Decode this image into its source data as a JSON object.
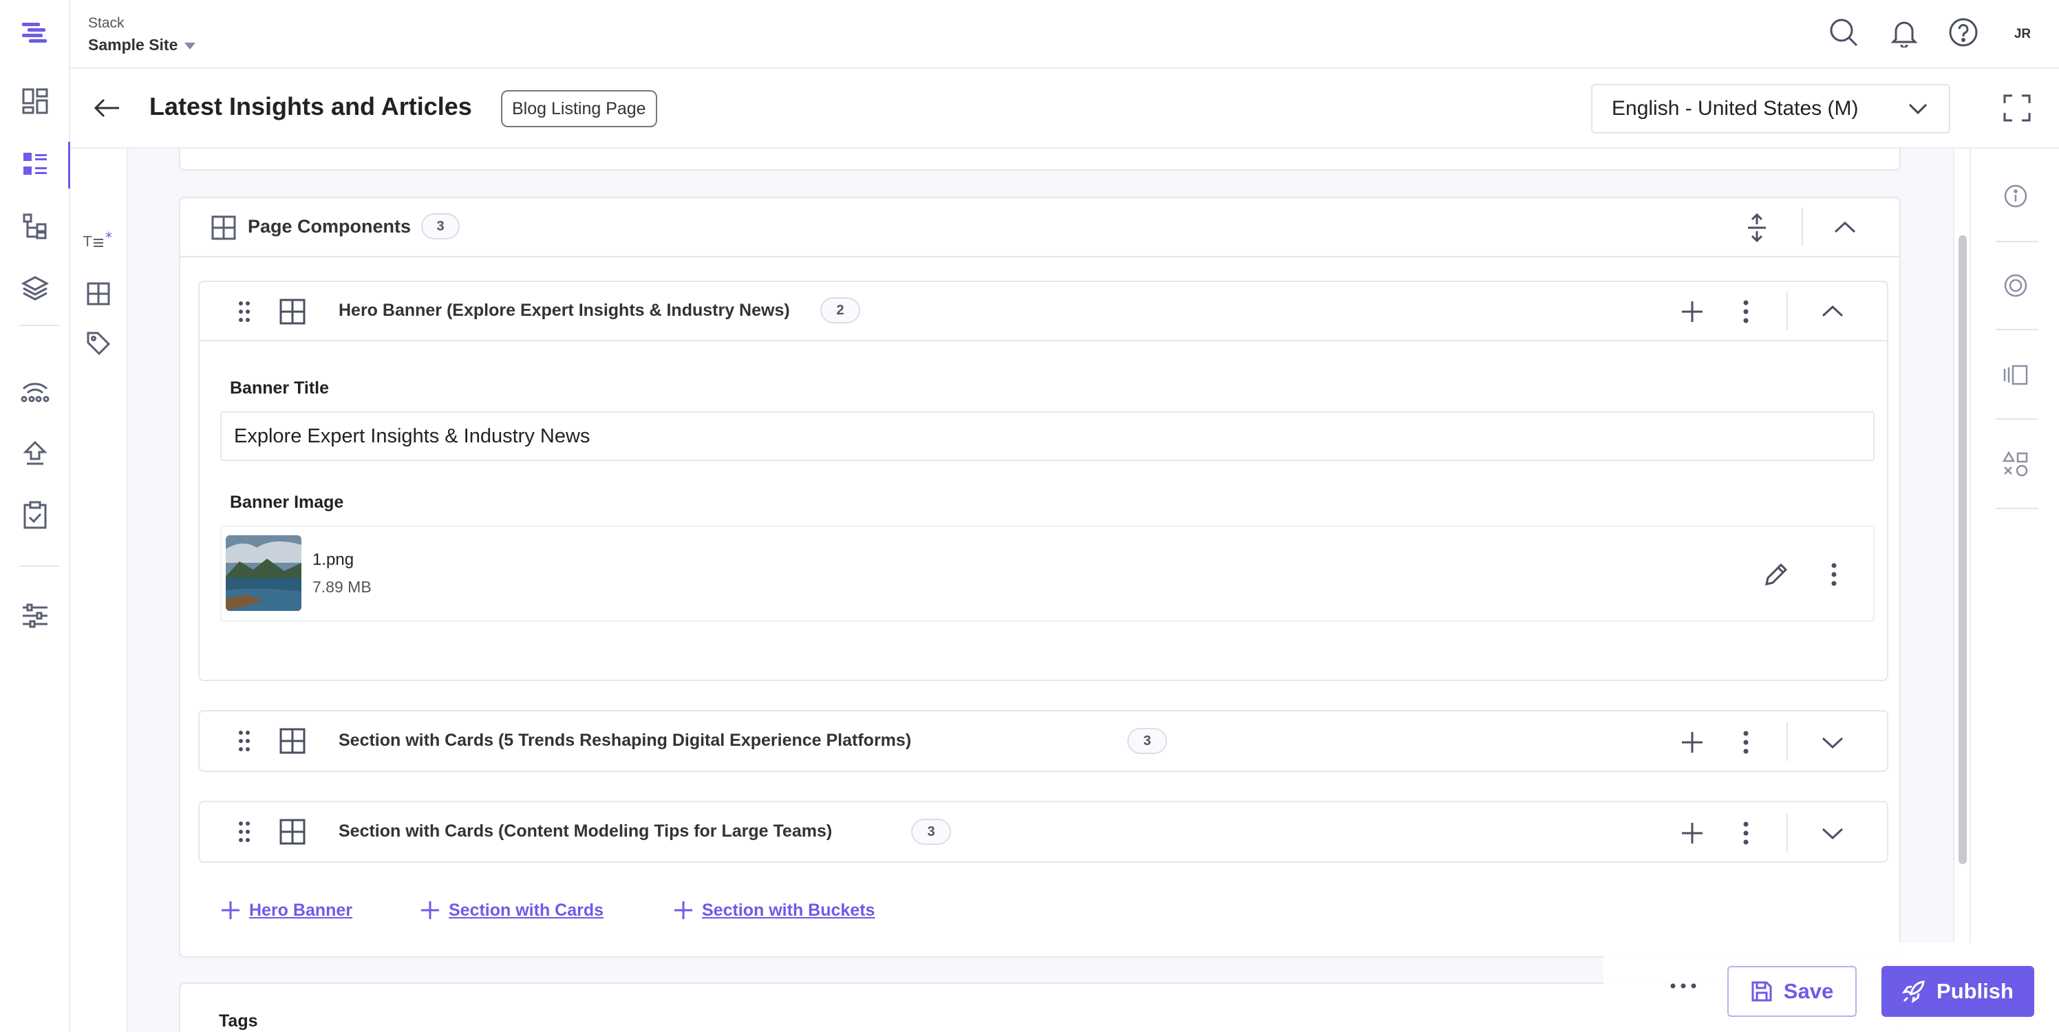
{
  "colors": {
    "accent": "#6c5ce7",
    "text": "#222222",
    "muted": "#555555",
    "border": "#e6e7ee"
  },
  "topbar": {
    "stack_label": "Stack",
    "site_name": "Sample Site",
    "avatar_initials": "JR"
  },
  "entry": {
    "title": "Latest Insights and Articles",
    "content_type": "Blog Listing Page",
    "locale": "English - United States (M)"
  },
  "page_components": {
    "label": "Page Components",
    "count": "3",
    "blocks": [
      {
        "title": "Hero Banner (Explore Expert Insights & Industry News)",
        "count": "2",
        "fields": {
          "banner_title_label": "Banner Title",
          "banner_title_value": "Explore Expert Insights & Industry News",
          "banner_image_label": "Banner Image",
          "file_name": "1.png",
          "file_size": "7.89 MB"
        }
      },
      {
        "title": "Section with Cards (5 Trends Reshaping Digital Experience Platforms)",
        "count": "3"
      },
      {
        "title": "Section with Cards (Content Modeling Tips for Large Teams)",
        "count": "3"
      }
    ],
    "add_links": [
      "Hero Banner",
      "Section with Cards",
      "Section with Buckets"
    ]
  },
  "tags": {
    "label": "Tags"
  },
  "actions": {
    "save": "Save",
    "publish": "Publish"
  },
  "icons": [
    "logo-icon",
    "dashboard-icon",
    "entries-icon",
    "content-models-icon",
    "assets-icon",
    "releases-icon",
    "publish-queue-icon",
    "tasks-icon",
    "settings-icon",
    "search-icon",
    "bell-icon",
    "help-icon",
    "back-arrow-icon",
    "chevron-down-icon",
    "fullscreen-icon",
    "text-field-icon",
    "modular-blocks-icon",
    "tag-icon",
    "info-icon",
    "target-icon",
    "versions-icon",
    "shapes-icon",
    "drag-handle-icon",
    "plus-icon",
    "kebab-icon",
    "edit-icon",
    "rocket-icon",
    "floppy-icon"
  ]
}
